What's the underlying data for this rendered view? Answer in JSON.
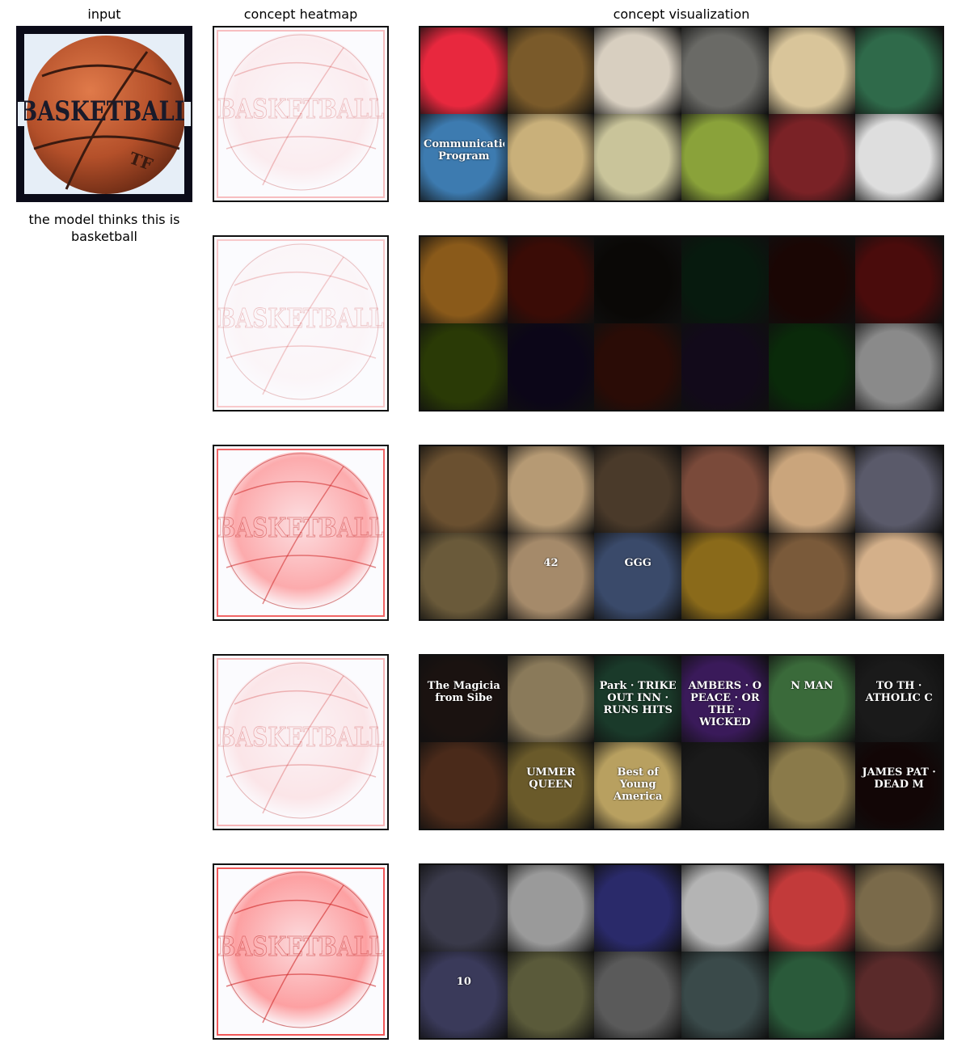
{
  "headers": {
    "input": "input",
    "heatmap": "concept heatmap",
    "visualization": "concept visualization"
  },
  "input_image": {
    "text": "BASKETBALL",
    "brand_text": "TF",
    "caption": "the model thinks this is basketball"
  },
  "heatmap_overlay_text": "BASKETBALL",
  "concepts": [
    {
      "intensity": 0.1,
      "tiles": [
        "#e8283e",
        "#7a5a2a",
        "#d8cfc0",
        "#6a6a66",
        "#d9c59a",
        "#2f6a4a",
        "#3d7bb0",
        "#c9b07a",
        "#c9c49a",
        "#8aa23a",
        "#7a2226",
        "#dedede"
      ],
      "tile_text": [
        {
          "row": 1,
          "col": 0,
          "text": "Communications Program"
        }
      ]
    },
    {
      "intensity": 0.04,
      "tiles": [
        "#8a5a1a",
        "#3a0c06",
        "#0a0806",
        "#071a0e",
        "#1a0604",
        "#4a0c0c",
        "#2a3a06",
        "#0c0618",
        "#2a0c06",
        "#120a1a",
        "#0a2a0a",
        "#8a8a8a"
      ],
      "tile_text": []
    },
    {
      "intensity": 0.55,
      "tiles": [
        "#6a5030",
        "#b69a74",
        "#4a3a2a",
        "#7a4a3a",
        "#caa57c",
        "#5a5a6a",
        "#6a5a3a",
        "#a58a6a",
        "#3a4a6a",
        "#8a6a1a",
        "#7a5a3a",
        "#d4b08a"
      ],
      "tile_text": [
        {
          "row": 1,
          "col": 1,
          "text": "42"
        },
        {
          "row": 1,
          "col": 2,
          "text": "GGG"
        }
      ]
    },
    {
      "intensity": 0.15,
      "tiles": [
        "#1a1210",
        "#8a7a5a",
        "#1a3a2a",
        "#3a1a5a",
        "#3a6a3a",
        "#1a1a1a",
        "#4a2a1a",
        "#6a5a2a",
        "#b8a060",
        "#1a1a1a",
        "#8a7a4a",
        "#120606"
      ],
      "tile_text": [
        {
          "row": 0,
          "col": 0,
          "text": "The Magicia from Sibe"
        },
        {
          "row": 0,
          "col": 2,
          "text": "Park · TRIKE OUT INN · RUNS HITS"
        },
        {
          "row": 0,
          "col": 3,
          "text": "AMBERS · O PEACE · OR THE · WICKED"
        },
        {
          "row": 0,
          "col": 4,
          "text": "N MAN"
        },
        {
          "row": 0,
          "col": 5,
          "text": "TO TH · ATHOLIC C"
        },
        {
          "row": 1,
          "col": 1,
          "text": "UMMER QUEEN"
        },
        {
          "row": 1,
          "col": 2,
          "text": "Best of Young America"
        },
        {
          "row": 1,
          "col": 5,
          "text": "JAMES PAT · DEAD M"
        }
      ]
    },
    {
      "intensity": 0.62,
      "tiles": [
        "#3a3a4a",
        "#9a9a9a",
        "#2a2a6a",
        "#b4b4b4",
        "#c23a3a",
        "#7a6a4a",
        "#3a3a5a",
        "#5a5a3a",
        "#5a5a5a",
        "#3a4a4a",
        "#2a5a3a",
        "#5a2a2a"
      ],
      "tile_text": [
        {
          "row": 1,
          "col": 0,
          "text": "10"
        }
      ]
    }
  ]
}
